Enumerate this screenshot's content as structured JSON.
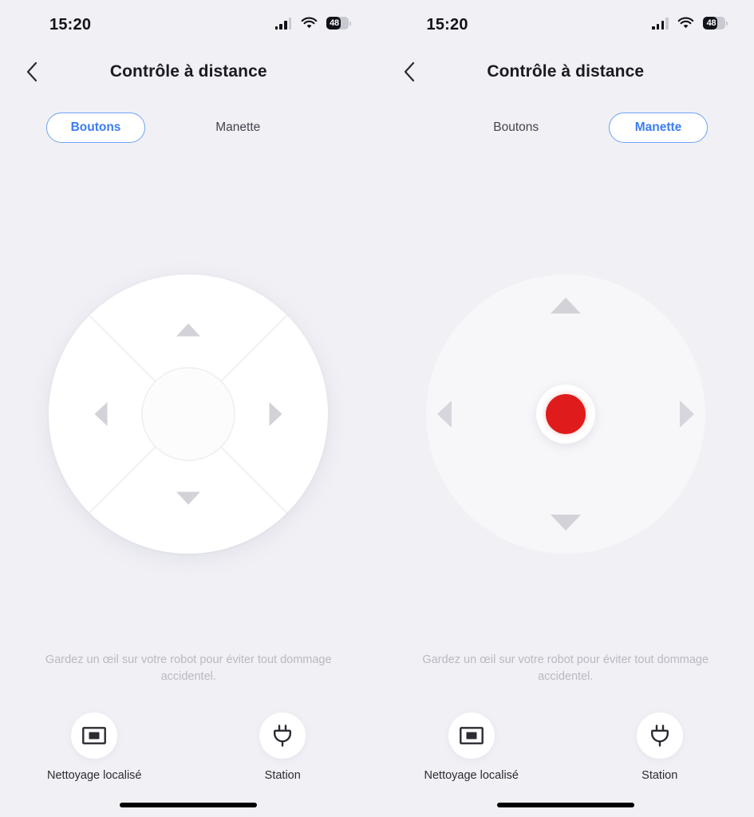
{
  "app": {
    "background_color": "#f0f0f5",
    "accent_color": "#3c7ef0",
    "joystick_knob_color": "#e01b1b"
  },
  "status_bar": {
    "time": "15:20",
    "battery_level": "48",
    "cellular_icon": "cellular-bars-icon",
    "wifi_icon": "wifi-icon",
    "battery_icon": "battery-icon"
  },
  "header": {
    "back_icon": "chevron-left-icon",
    "title": "Contrôle à distance"
  },
  "tabs": {
    "buttons_label": "Boutons",
    "joystick_label": "Manette"
  },
  "hint": {
    "text": "Gardez un œil sur votre robot pour éviter tout dommage accidentel."
  },
  "dpad": {
    "up_icon": "arrow-up-icon",
    "down_icon": "arrow-down-icon",
    "left_icon": "arrow-left-icon",
    "right_icon": "arrow-right-icon",
    "center_icon": "dpad-center-hub"
  },
  "joystick": {
    "up_icon": "arrow-up-icon",
    "down_icon": "arrow-down-icon",
    "left_icon": "arrow-left-icon",
    "right_icon": "arrow-right-icon",
    "knob_icon": "joystick-knob"
  },
  "actions": {
    "spot_clean": {
      "label": "Nettoyage localisé",
      "icon": "spot-clean-icon"
    },
    "dock": {
      "label": "Station",
      "icon": "power-plug-icon"
    }
  },
  "panels": [
    {
      "active_tab": "Boutons",
      "control_mode": "dpad"
    },
    {
      "active_tab": "Manette",
      "control_mode": "joystick"
    }
  ]
}
